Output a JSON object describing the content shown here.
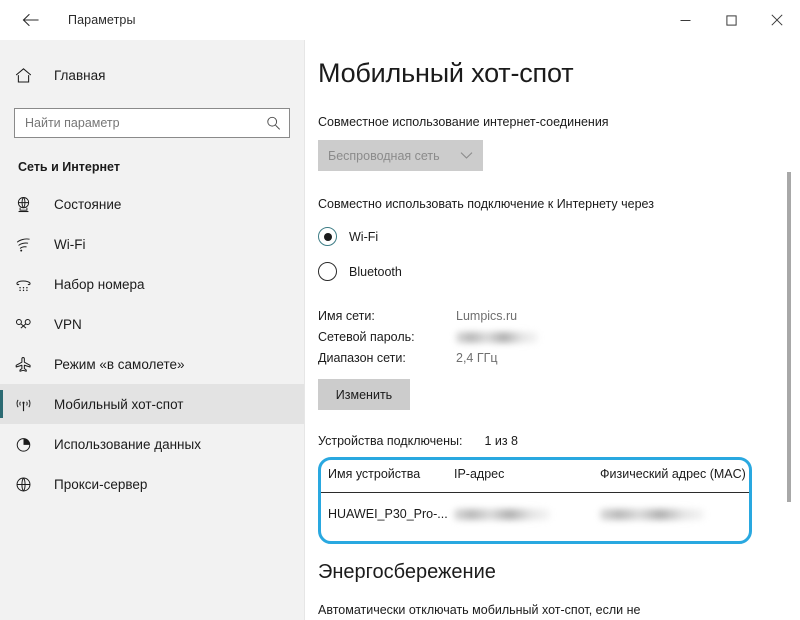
{
  "window": {
    "title": "Параметры",
    "back_icon": "back-arrow-icon",
    "minimize_label": "—",
    "maximize_label": "□",
    "close_label": "✕"
  },
  "colors": {
    "accent": "#2b6a72",
    "annotation": "#29a8e0",
    "sidebar_bg": "#f2f2f2",
    "content_bg": "#ffffff"
  },
  "sidebar": {
    "home_label": "Главная",
    "home_icon": "home-icon",
    "search": {
      "placeholder": "Найти параметр",
      "value": "",
      "icon": "search-icon"
    },
    "section_title": "Сеть и Интернет",
    "items": [
      {
        "label": "Состояние",
        "icon": "network-status-icon",
        "selected": false
      },
      {
        "label": "Wi-Fi",
        "icon": "wifi-icon",
        "selected": false
      },
      {
        "label": "Набор номера",
        "icon": "dial-up-icon",
        "selected": false
      },
      {
        "label": "VPN",
        "icon": "vpn-key-icon",
        "selected": false
      },
      {
        "label": "Режим «в самолете»",
        "icon": "airplane-icon",
        "selected": false
      },
      {
        "label": "Мобильный хот-спот",
        "icon": "hotspot-icon",
        "selected": true
      },
      {
        "label": "Использование данных",
        "icon": "pie-chart-icon",
        "selected": false
      },
      {
        "label": "Прокси-сервер",
        "icon": "globe-icon",
        "selected": false
      }
    ]
  },
  "main": {
    "page_title": "Мобильный хот-спот",
    "share_section_label": "Совместное использование интернет-соединения",
    "share_combo": {
      "value": "Беспроводная сеть",
      "chevron_icon": "chevron-down-icon",
      "disabled": true
    },
    "connection_section_label": "Совместно использовать подключение к Интернету через",
    "radios": [
      {
        "label": "Wi-Fi",
        "checked": true
      },
      {
        "label": "Bluetooth",
        "checked": false
      }
    ],
    "network_info": [
      {
        "key": "Имя сети:",
        "value": "Lumpics.ru",
        "blurred": false
      },
      {
        "key": "Сетевой пароль:",
        "value": "",
        "blurred": true
      },
      {
        "key": "Диапазон сети:",
        "value": "2,4 ГГц",
        "blurred": false
      }
    ],
    "edit_button_label": "Изменить",
    "devices": {
      "label": "Устройства подключены:",
      "count": "1 из 8",
      "columns": [
        "Имя устройства",
        "IP-адрес",
        "Физический адрес (MAC)"
      ],
      "rows": [
        {
          "name": "HUAWEI_P30_Pro-...",
          "ip": "",
          "mac": "",
          "ip_blurred": true,
          "mac_blurred": true
        }
      ]
    },
    "power_title": "Энергосбережение",
    "power_desc": "Автоматически отключать мобильный хот-спот, если не"
  }
}
